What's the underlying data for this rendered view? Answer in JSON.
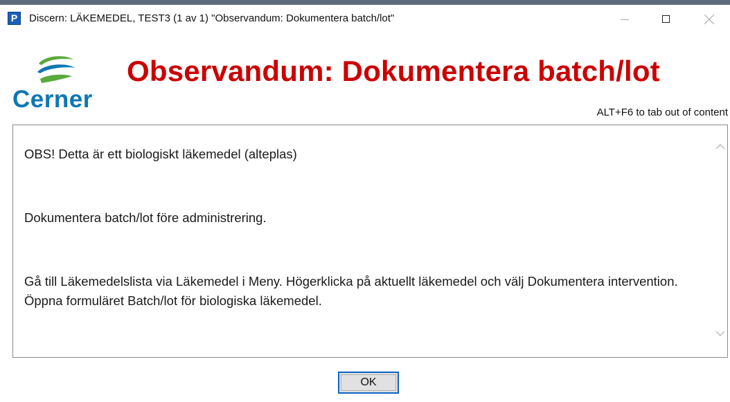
{
  "window": {
    "app_icon_letter": "P",
    "title": "Discern: LÄKEMEDEL, TEST3 (1 av 1) \"Observandum: Dokumentera batch/lot\"",
    "controls": [
      "minimize-icon",
      "maximize-icon",
      "close-icon"
    ]
  },
  "logo": {
    "text": "Cerner",
    "trademark": "·",
    "colors": {
      "green": "#5aaa3c",
      "blue": "#0e77b5"
    }
  },
  "heading": {
    "text": "Observandum: Dokumentera batch/lot",
    "color": "#cc0000"
  },
  "tab_hint": "ALT+F6 to tab out of content",
  "content": {
    "paragraphs": [
      "OBS! Detta är ett biologiskt läkemedel (alteplas)",
      "Dokumentera batch/lot före administrering.",
      "Gå till Läkemedelslista via Läkemedel i Meny. Högerklicka på aktuellt läkemedel och välj Dokumentera intervention. Öppna formuläret Batch/lot för biologiska läkemedel."
    ],
    "scroll_icons": [
      "chevron-up-icon",
      "chevron-down-icon"
    ]
  },
  "buttons": {
    "ok_label": "OK",
    "focus_color": "#0b63c4"
  }
}
